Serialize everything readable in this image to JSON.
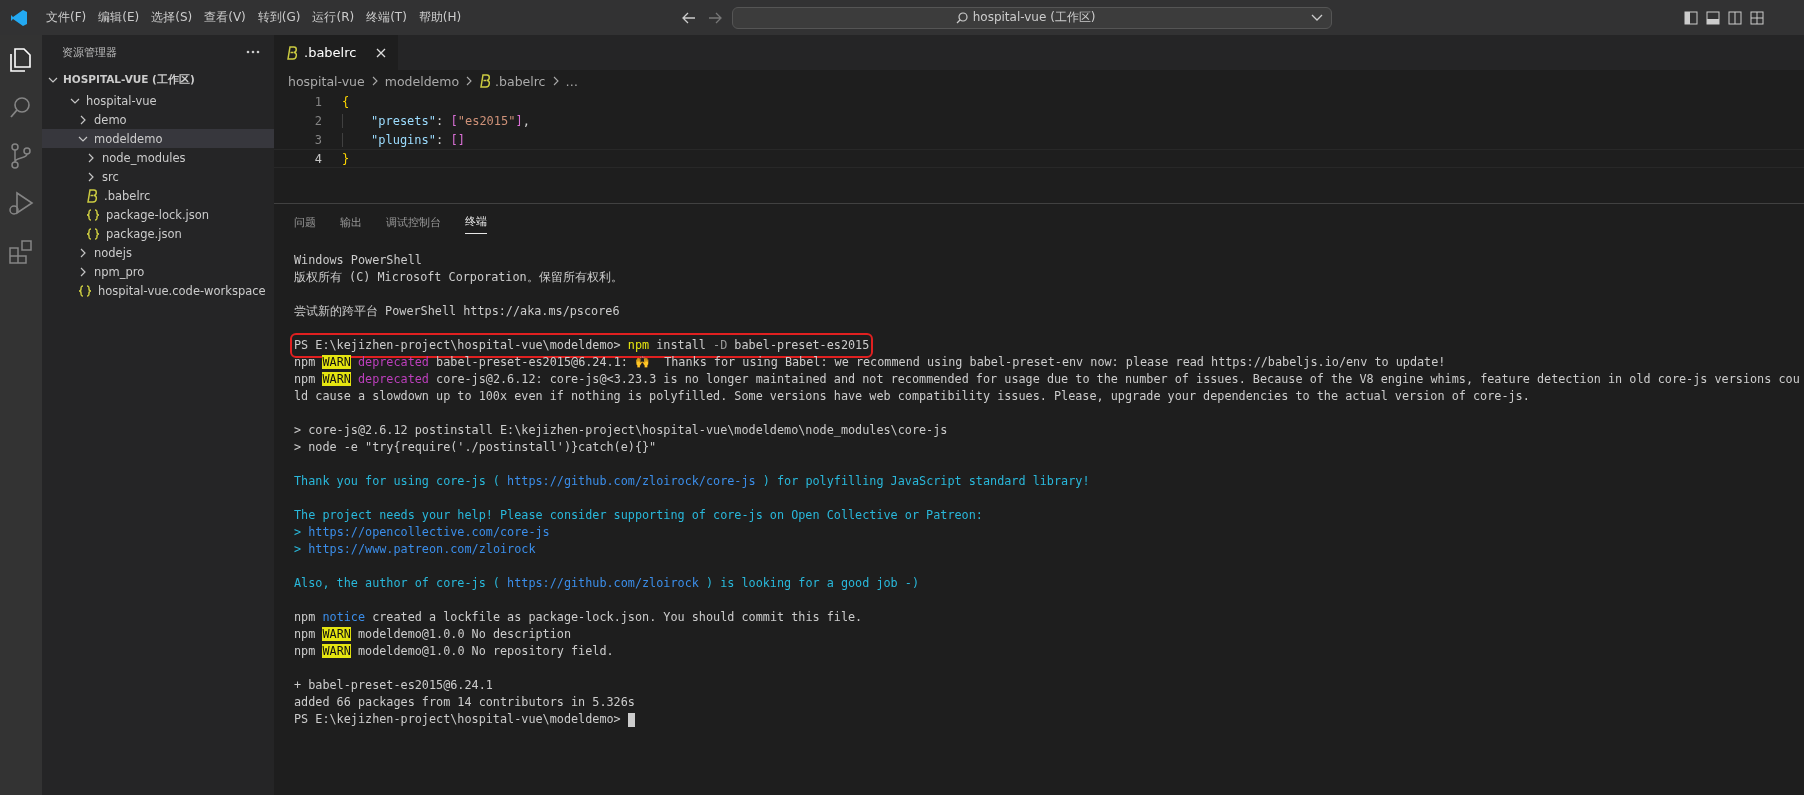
{
  "title_bar": {
    "menu": [
      "文件(F)",
      "编辑(E)",
      "选择(S)",
      "查看(V)",
      "转到(G)",
      "运行(R)",
      "终端(T)",
      "帮助(H)"
    ],
    "command_center": "hospital-vue (工作区)"
  },
  "activity_bar": [
    {
      "kind": "files",
      "selected": true
    },
    {
      "kind": "search",
      "selected": false
    },
    {
      "kind": "scm",
      "selected": false
    },
    {
      "kind": "debug",
      "selected": false
    },
    {
      "kind": "extensions",
      "selected": false
    }
  ],
  "sidebar": {
    "title": "资源管理器",
    "workspace": {
      "label": "HOSPITAL-VUE (工作区)",
      "expanded": true
    },
    "tree": [
      {
        "label": "hospital-vue",
        "kind": "folder",
        "expanded": true,
        "selected": false,
        "children": [
          {
            "label": "demo",
            "kind": "folder",
            "expanded": false,
            "selected": false
          },
          {
            "label": "modeldemo",
            "kind": "folder",
            "expanded": true,
            "selected": true,
            "children": [
              {
                "label": "node_modules",
                "kind": "folder",
                "expanded": false,
                "selected": false
              },
              {
                "label": "src",
                "kind": "folder",
                "expanded": false,
                "selected": false
              },
              {
                "label": ".babelrc",
                "kind": "babel",
                "selected": false
              },
              {
                "label": "package-lock.json",
                "kind": "json",
                "selected": false
              },
              {
                "label": "package.json",
                "kind": "json",
                "selected": false
              }
            ]
          },
          {
            "label": "nodejs",
            "kind": "folder",
            "expanded": false,
            "selected": false
          },
          {
            "label": "npm_pro",
            "kind": "folder",
            "expanded": false,
            "selected": false
          },
          {
            "label": "hospital-vue.code-workspace",
            "kind": "json",
            "selected": false
          }
        ]
      }
    ]
  },
  "editor": {
    "tabs": [
      {
        "label": ".babelrc",
        "kind": "babel",
        "selected": true
      }
    ],
    "breadcrumb": [
      {
        "text": "hospital-vue",
        "kind": "plain"
      },
      {
        "text": "modeldemo",
        "kind": "plain"
      },
      {
        "text": ".babelrc",
        "kind": "babel"
      },
      {
        "text": "…",
        "kind": "plain"
      }
    ],
    "lines": [
      {
        "number": "1",
        "current": false,
        "indented": false,
        "tokens": [
          {
            "text": "{",
            "kind": "brace"
          }
        ]
      },
      {
        "number": "2",
        "current": false,
        "indented": true,
        "tokens": [
          {
            "text": "\"presets\"",
            "kind": "key"
          },
          {
            "text": ": ",
            "kind": "punct"
          },
          {
            "text": "[",
            "kind": "bracket"
          },
          {
            "text": "\"es2015\"",
            "kind": "string"
          },
          {
            "text": "]",
            "kind": "bracket"
          },
          {
            "text": ",",
            "kind": "punct"
          }
        ]
      },
      {
        "number": "3",
        "current": false,
        "indented": true,
        "tokens": [
          {
            "text": "\"plugins\"",
            "kind": "key"
          },
          {
            "text": ": ",
            "kind": "punct"
          },
          {
            "text": "[]",
            "kind": "bracket"
          }
        ]
      },
      {
        "number": "4",
        "current": true,
        "indented": false,
        "tokens": [
          {
            "text": "}",
            "kind": "brace"
          }
        ]
      }
    ]
  },
  "panel": {
    "tabs": [
      {
        "label": "问题",
        "selected": false
      },
      {
        "label": "输出",
        "selected": false
      },
      {
        "label": "调试控制台",
        "selected": false
      },
      {
        "label": "终端",
        "selected": true
      }
    ],
    "terminal": [
      {
        "kind": "text",
        "segments": [
          {
            "text": "Windows PowerShell",
            "kind": "plain"
          }
        ]
      },
      {
        "kind": "text",
        "segments": [
          {
            "text": "版权所有 (C) Microsoft Corporation。保留所有权利。",
            "kind": "plain"
          }
        ]
      },
      {
        "kind": "blank"
      },
      {
        "kind": "text",
        "segments": [
          {
            "text": "尝试新的跨平台 PowerShell https://aka.ms/pscore6",
            "kind": "plain"
          }
        ]
      },
      {
        "kind": "blank"
      },
      {
        "kind": "text",
        "highlighted": true,
        "segments": [
          {
            "text": "PS E:\\kejizhen-project\\hospital-vue\\modeldemo> ",
            "kind": "plain"
          },
          {
            "text": "npm",
            "kind": "command"
          },
          {
            "text": " install ",
            "kind": "plain"
          },
          {
            "text": "-D",
            "kind": "flag"
          },
          {
            "text": " babel-preset-es2015",
            "kind": "plain"
          }
        ]
      },
      {
        "kind": "text",
        "segments": [
          {
            "text": "npm ",
            "kind": "plain"
          },
          {
            "text": "WARN",
            "kind": "warn"
          },
          {
            "text": " deprecated",
            "kind": "deprecated"
          },
          {
            "text": " babel-preset-es2015@6.24.1: 🙌  Thanks for using Babel: we recommend using babel-preset-env now: please read https://babeljs.io/env to update!",
            "kind": "plain"
          }
        ]
      },
      {
        "kind": "text",
        "segments": [
          {
            "text": "npm ",
            "kind": "plain"
          },
          {
            "text": "WARN",
            "kind": "warn"
          },
          {
            "text": " deprecated",
            "kind": "deprecated"
          },
          {
            "text": " core-js@2.6.12: core-js@<3.23.3 is no longer maintained and not recommended for usage due to the number of issues. Because of the V8 engine whims, feature detection in old core-js versions cou",
            "kind": "plain"
          }
        ]
      },
      {
        "kind": "text",
        "segments": [
          {
            "text": "ld cause a slowdown up to 100x even if nothing is polyfilled. Some versions have web compatibility issues. Please, upgrade your dependencies to the actual version of core-js.",
            "kind": "plain"
          }
        ]
      },
      {
        "kind": "blank"
      },
      {
        "kind": "text",
        "segments": [
          {
            "text": "> core-js@2.6.12 postinstall E:\\kejizhen-project\\hospital-vue\\modeldemo\\node_modules\\core-js",
            "kind": "plain"
          }
        ]
      },
      {
        "kind": "text",
        "segments": [
          {
            "text": "> node -e \"try{require('./postinstall')}catch(e){}\"",
            "kind": "plain"
          }
        ]
      },
      {
        "kind": "blank"
      },
      {
        "kind": "text",
        "segments": [
          {
            "text": "Thank you for using core-js ( ",
            "kind": "info"
          },
          {
            "text": "https://github.com/zloirock/core-js",
            "kind": "link"
          },
          {
            "text": " ) for polyfilling JavaScript standard library!",
            "kind": "info"
          }
        ]
      },
      {
        "kind": "blank"
      },
      {
        "kind": "text",
        "segments": [
          {
            "text": "The project needs your help! Please consider supporting of core-js on Open Collective or Patreon:",
            "kind": "info"
          }
        ]
      },
      {
        "kind": "text",
        "segments": [
          {
            "text": "> ",
            "kind": "info"
          },
          {
            "text": "https://opencollective.com/core-js",
            "kind": "link"
          }
        ]
      },
      {
        "kind": "text",
        "segments": [
          {
            "text": "> ",
            "kind": "info"
          },
          {
            "text": "https://www.patreon.com/zloirock",
            "kind": "link"
          }
        ]
      },
      {
        "kind": "blank"
      },
      {
        "kind": "text",
        "segments": [
          {
            "text": "Also, the author of core-js ( ",
            "kind": "info"
          },
          {
            "text": "https://github.com/zloirock",
            "kind": "link"
          },
          {
            "text": " ) is looking for a good job -)",
            "kind": "info"
          }
        ]
      },
      {
        "kind": "blank"
      },
      {
        "kind": "text",
        "segments": [
          {
            "text": "npm ",
            "kind": "plain"
          },
          {
            "text": "notice",
            "kind": "notice"
          },
          {
            "text": " created a lockfile as package-lock.json. You should commit this file.",
            "kind": "plain"
          }
        ]
      },
      {
        "kind": "text",
        "segments": [
          {
            "text": "npm ",
            "kind": "plain"
          },
          {
            "text": "WARN",
            "kind": "warn"
          },
          {
            "text": " modeldemo@1.0.0 No description",
            "kind": "plain"
          }
        ]
      },
      {
        "kind": "text",
        "segments": [
          {
            "text": "npm ",
            "kind": "plain"
          },
          {
            "text": "WARN",
            "kind": "warn"
          },
          {
            "text": " modeldemo@1.0.0 No repository field.",
            "kind": "plain"
          }
        ]
      },
      {
        "kind": "blank"
      },
      {
        "kind": "text",
        "segments": [
          {
            "text": "+ babel-preset-es2015@6.24.1",
            "kind": "plain"
          }
        ]
      },
      {
        "kind": "text",
        "segments": [
          {
            "text": "added 66 packages from 14 contributors in 5.326s",
            "kind": "plain"
          }
        ]
      },
      {
        "kind": "text",
        "cursor": true,
        "segments": [
          {
            "text": "PS E:\\kejizhen-project\\hospital-vue\\modeldemo> ",
            "kind": "plain"
          }
        ]
      }
    ]
  }
}
